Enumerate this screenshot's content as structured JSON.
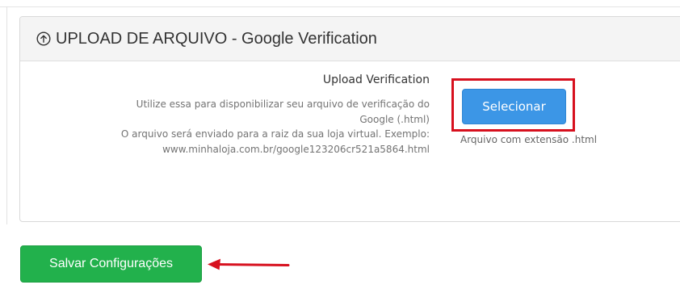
{
  "panel": {
    "title": "UPLOAD DE ARQUIVO - Google Verification"
  },
  "field": {
    "label": "Upload Verification",
    "help_lines": [
      "Utilize essa para disponibilizar seu arquivo de verificação do",
      "Google (.html)",
      "O arquivo será enviado para a raiz da sua loja virtual. Exemplo:",
      "www.minhaloja.com.br/google123206cr521a5864.html"
    ],
    "button_label": "Selecionar",
    "file_hint": "Arquivo com extensão .html"
  },
  "footer": {
    "save_label": "Salvar Configurações"
  },
  "colors": {
    "select_button": "#3c96e6",
    "save_button": "#22b14c",
    "annotation": "#d7101e"
  },
  "icons": {
    "title_icon": "upload-circle-icon",
    "annotation_arrow": "red-arrow-icon"
  }
}
